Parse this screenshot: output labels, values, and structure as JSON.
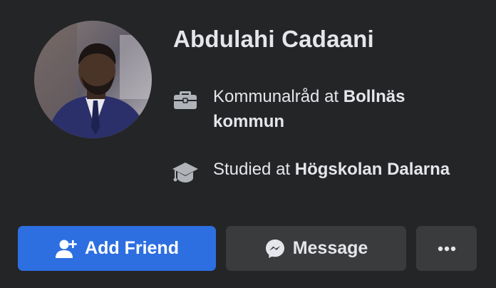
{
  "profile": {
    "name": "Abdulahi Cadaani",
    "avatar_alt": "Profile photo"
  },
  "work": {
    "prefix": "Kommunalråd at ",
    "org": "Bollnäs kommun",
    "icon": "briefcase-icon"
  },
  "education": {
    "prefix": "Studied at ",
    "org": "Högskolan Dalarna",
    "icon": "graduation-cap-icon"
  },
  "actions": {
    "add_friend_label": "Add Friend",
    "message_label": "Message",
    "more_icon": "more-dots-icon"
  },
  "colors": {
    "background": "#242526",
    "primary_button": "#2d6fe0",
    "secondary_button": "#3a3b3c",
    "text": "#e4e6eb"
  }
}
